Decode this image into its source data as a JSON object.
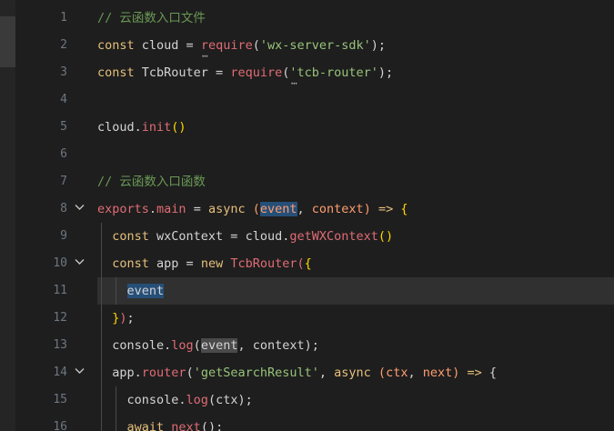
{
  "editor": {
    "lines": [
      {
        "num": "1",
        "tokens": [
          {
            "t": "// 云函数入口文件",
            "c": "t-comment"
          }
        ]
      },
      {
        "num": "2",
        "tokens": [
          {
            "t": "const ",
            "c": "t-kw"
          },
          {
            "t": "cloud = ",
            "c": "t-id"
          },
          {
            "t": "require",
            "c": "t-fn"
          },
          {
            "t": "(",
            "c": "t-id"
          },
          {
            "t": "'wx-server-sdk'",
            "c": "t-str"
          },
          {
            "t": ");",
            "c": "t-id"
          }
        ]
      },
      {
        "num": "3",
        "tokens": [
          {
            "t": "const ",
            "c": "t-kw"
          },
          {
            "t": "TcbRouter = ",
            "c": "t-id"
          },
          {
            "t": "require",
            "c": "t-fn"
          },
          {
            "t": "(",
            "c": "t-id"
          },
          {
            "t": "'tcb-router'",
            "c": "t-str"
          },
          {
            "t": ");",
            "c": "t-id"
          }
        ]
      },
      {
        "num": "4",
        "tokens": []
      },
      {
        "num": "5",
        "tokens": [
          {
            "t": "cloud.",
            "c": "t-id"
          },
          {
            "t": "init",
            "c": "t-fn"
          },
          {
            "t": "()",
            "c": "t-br"
          }
        ]
      },
      {
        "num": "6",
        "tokens": []
      },
      {
        "num": "7",
        "tokens": [
          {
            "t": "// 云函数入口函数",
            "c": "t-comment"
          }
        ]
      },
      {
        "num": "8",
        "fold": true,
        "tokens": [
          {
            "t": "exports",
            "c": "t-fn"
          },
          {
            "t": ".",
            "c": "t-id"
          },
          {
            "t": "main",
            "c": "t-fn"
          },
          {
            "t": " = ",
            "c": "t-id"
          },
          {
            "t": "async ",
            "c": "t-kw"
          },
          {
            "t": "(",
            "c": "t-param"
          },
          {
            "t": "event",
            "c": "t-param hi-sel"
          },
          {
            "t": ", ",
            "c": "t-id"
          },
          {
            "t": "context",
            "c": "t-param"
          },
          {
            "t": ") ",
            "c": "t-param"
          },
          {
            "t": "=> ",
            "c": "t-kw"
          },
          {
            "t": "{",
            "c": "t-br"
          }
        ]
      },
      {
        "num": "9",
        "guides": [
          111
        ],
        "tokens": [
          {
            "t": "  const ",
            "c": "t-kw"
          },
          {
            "t": "wxContext = cloud.",
            "c": "t-id"
          },
          {
            "t": "getWXContext",
            "c": "t-fn"
          },
          {
            "t": "()",
            "c": "t-br"
          }
        ]
      },
      {
        "num": "10",
        "fold": true,
        "guides": [
          111
        ],
        "tokens": [
          {
            "t": "  const ",
            "c": "t-kw"
          },
          {
            "t": "app = ",
            "c": "t-id"
          },
          {
            "t": "new ",
            "c": "t-kw"
          },
          {
            "t": "TcbRouter",
            "c": "t-fn"
          },
          {
            "t": "(",
            "c": "t-fn"
          },
          {
            "t": "{",
            "c": "t-br"
          }
        ]
      },
      {
        "num": "11",
        "highlight": true,
        "guides": [
          111,
          127
        ],
        "tokens": [
          {
            "t": "    ",
            "c": "t-id"
          },
          {
            "t": "event",
            "c": "t-id hi-sel"
          }
        ]
      },
      {
        "num": "12",
        "guides": [
          111
        ],
        "tokens": [
          {
            "t": "  ",
            "c": "t-id"
          },
          {
            "t": "}",
            "c": "t-br"
          },
          {
            "t": ")",
            "c": "t-fn"
          },
          {
            "t": ";",
            "c": "t-id"
          }
        ]
      },
      {
        "num": "13",
        "guides": [
          111
        ],
        "tokens": [
          {
            "t": "  console.",
            "c": "t-id"
          },
          {
            "t": "log",
            "c": "t-fn"
          },
          {
            "t": "(",
            "c": "t-id"
          },
          {
            "t": "event",
            "c": "t-id hi-word"
          },
          {
            "t": ", context",
            "c": "t-id"
          },
          {
            "t": ");",
            "c": "t-id"
          }
        ]
      },
      {
        "num": "14",
        "fold": true,
        "guides": [
          111
        ],
        "tokens": [
          {
            "t": "  app.",
            "c": "t-id"
          },
          {
            "t": "router",
            "c": "t-fn"
          },
          {
            "t": "(",
            "c": "t-id"
          },
          {
            "t": "'getSearchResult'",
            "c": "t-str"
          },
          {
            "t": ", ",
            "c": "t-id"
          },
          {
            "t": "async ",
            "c": "t-kw"
          },
          {
            "t": "(",
            "c": "t-param"
          },
          {
            "t": "ctx",
            "c": "t-param"
          },
          {
            "t": ", ",
            "c": "t-id"
          },
          {
            "t": "next",
            "c": "t-param"
          },
          {
            "t": ") ",
            "c": "t-param"
          },
          {
            "t": "=> ",
            "c": "t-kw"
          },
          {
            "t": "{",
            "c": "t-id"
          }
        ]
      },
      {
        "num": "15",
        "guides": [
          111,
          127
        ],
        "tokens": [
          {
            "t": "    console.",
            "c": "t-id"
          },
          {
            "t": "log",
            "c": "t-fn"
          },
          {
            "t": "(ctx);",
            "c": "t-id"
          }
        ]
      },
      {
        "num": "16",
        "guides": [
          111,
          127
        ],
        "tokens": [
          {
            "t": "    ",
            "c": "t-id"
          },
          {
            "t": "await ",
            "c": "t-kw"
          },
          {
            "t": "next",
            "c": "t-fn"
          },
          {
            "t": "();",
            "c": "t-id"
          }
        ]
      }
    ],
    "hint_marker": "⋯",
    "fold_icon": "chevron-down-icon",
    "colors": {
      "background": "#1e1e1e",
      "comment": "#6a9955",
      "keyword": "#e6c07b",
      "string": "#98c379",
      "function": "#e06c75",
      "parameter": "#ff9d6f",
      "selection": "#264f78"
    }
  }
}
